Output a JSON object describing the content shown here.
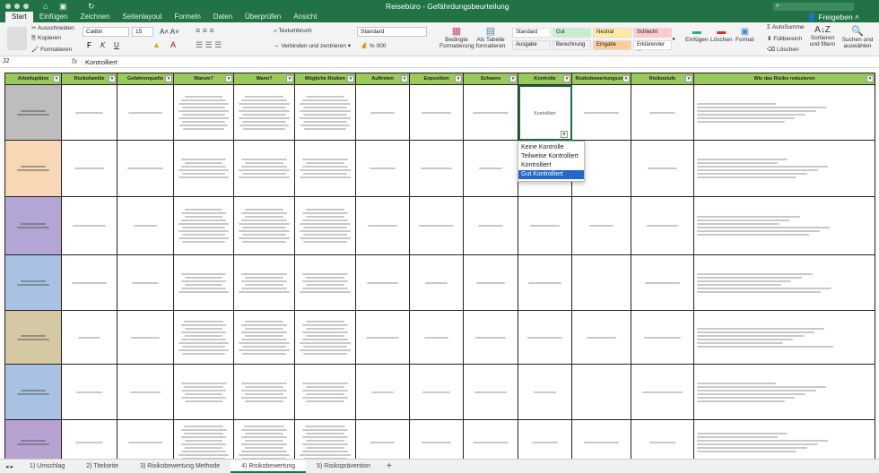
{
  "window": {
    "title": "Reisebüro - Gefährdungsbeurteilung",
    "share": "Freigeben"
  },
  "tabs": [
    "Start",
    "Einfügen",
    "Zeichnen",
    "Seitenlayout",
    "Formeln",
    "Daten",
    "Überprüfen",
    "Ansicht"
  ],
  "ribbon": {
    "clipboard": {
      "cut": "Ausschneiden",
      "copy": "Kopieren",
      "format": "Formatieren"
    },
    "font": {
      "name": "Calibri",
      "size": "15",
      "bold": "F",
      "italic": "K",
      "underline": "U"
    },
    "alignment": {
      "wrap": "Textumbruch",
      "merge": "Verbinden und zentrieren"
    },
    "number": {
      "format": "Standard",
      "percent": "%",
      "thousands": "000"
    },
    "conditional": "Bedingte Formatierung",
    "as_table": "Als Tabelle formatieren",
    "styles": [
      {
        "label": "Standard",
        "bg": "#ffffff"
      },
      {
        "label": "Gut",
        "bg": "#c6efce"
      },
      {
        "label": "Neutral",
        "bg": "#ffeb9c"
      },
      {
        "label": "Schlecht",
        "bg": "#ffc7ce"
      },
      {
        "label": "Ausgabe",
        "bg": "#f2f2f2"
      },
      {
        "label": "Berechnung",
        "bg": "#f2f2f2"
      },
      {
        "label": "Eingabe",
        "bg": "#ffcc99"
      },
      {
        "label": "Erklärender ...",
        "bg": "#ffffff"
      }
    ],
    "cells": {
      "insert": "Einfügen",
      "delete": "Löschen",
      "format": "Format"
    },
    "editing": {
      "autosum": "AutoSumme",
      "fill": "Füllbereich",
      "clear": "Löschen",
      "sort": "Sortieren und filtern",
      "find": "Suchen und auswählen"
    }
  },
  "formula_bar": {
    "cell": "J2",
    "fx": "fx",
    "value": "Kontrolliert"
  },
  "sheet": {
    "headers": [
      "Arbeitsplätze",
      "Risikofamilie",
      "Gefahrenquelle",
      "Warum?",
      "Wann?",
      "Mögliche Risiken",
      "Auftreten",
      "Exposition",
      "Schwere",
      "Kontrolle",
      "Risikobewertungszahl",
      "Risikostufe",
      "Wie das Risiko reduzieren"
    ],
    "row_colors": [
      "#bdbdbd",
      "#f8d8b4",
      "#b4a6d4",
      "#a9c2e4",
      "#d5c9a4",
      "#a9c2e4",
      "#b7a2d2"
    ],
    "selected_value": "Kontrolliert",
    "dropdown_options": [
      "Keine Kontrolle",
      "Teilweise Kontrolliert",
      "Kontrolliert",
      "Gut Kontrolliert"
    ],
    "dropdown_highlight": "Gut Kontrolliert"
  },
  "sheet_tabs": [
    "1) Umschlag",
    "2) Titelseite",
    "3) Risikobewertung Methode",
    "4) Risikobewertung",
    "5) Risikoprävention"
  ],
  "active_sheet": "4) Risikobewertung"
}
